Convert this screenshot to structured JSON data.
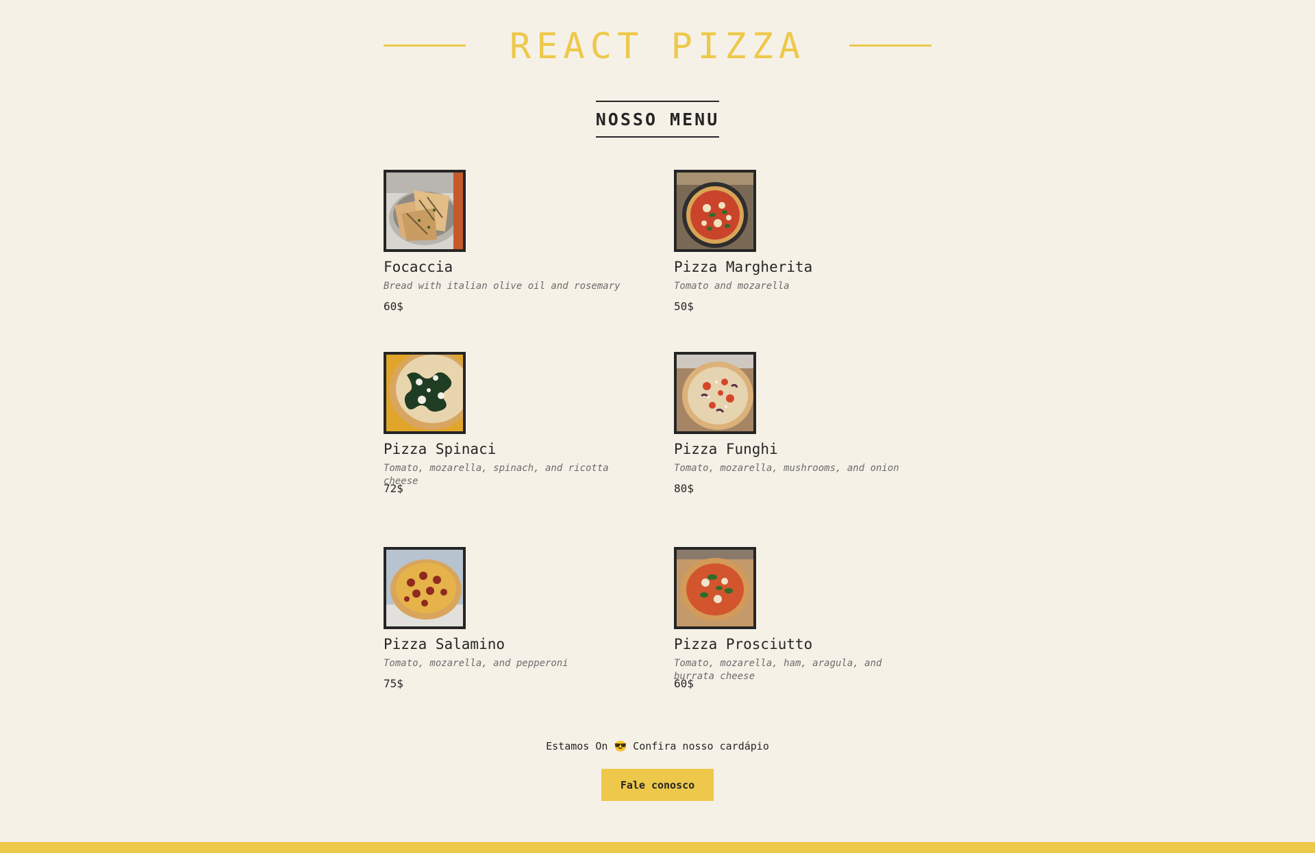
{
  "header": {
    "title": "REACT PIZZA"
  },
  "menu": {
    "title": "NOSSO MENU",
    "items": [
      {
        "name": "Focaccia",
        "description": "Bread with italian olive oil and rosemary",
        "price": "60$",
        "image": "focaccia-photo"
      },
      {
        "name": "Pizza Margherita",
        "description": "Tomato and mozarella",
        "price": "50$",
        "image": "margherita-photo"
      },
      {
        "name": "Pizza Spinaci",
        "description": "Tomato, mozarella, spinach, and ricotta cheese",
        "price": "72$",
        "image": "spinaci-photo"
      },
      {
        "name": "Pizza Funghi",
        "description": "Tomato, mozarella, mushrooms, and onion",
        "price": "80$",
        "image": "funghi-photo"
      },
      {
        "name": "Pizza Salamino",
        "description": "Tomato, mozarella, and pepperoni",
        "price": "75$",
        "image": "salamino-photo"
      },
      {
        "name": "Pizza Prosciutto",
        "description": "Tomato, mozarella, ham, aragula, and burrata cheese",
        "price": "60$",
        "image": "prosciutto-photo"
      }
    ]
  },
  "footer": {
    "status_text": "Estamos On 😎 Confira nosso cardápio",
    "contact_button": "Fale conosco"
  },
  "colors": {
    "background": "#f6f1e7",
    "accent": "#edc84b",
    "text": "#252525",
    "muted": "#6b6b6b"
  }
}
